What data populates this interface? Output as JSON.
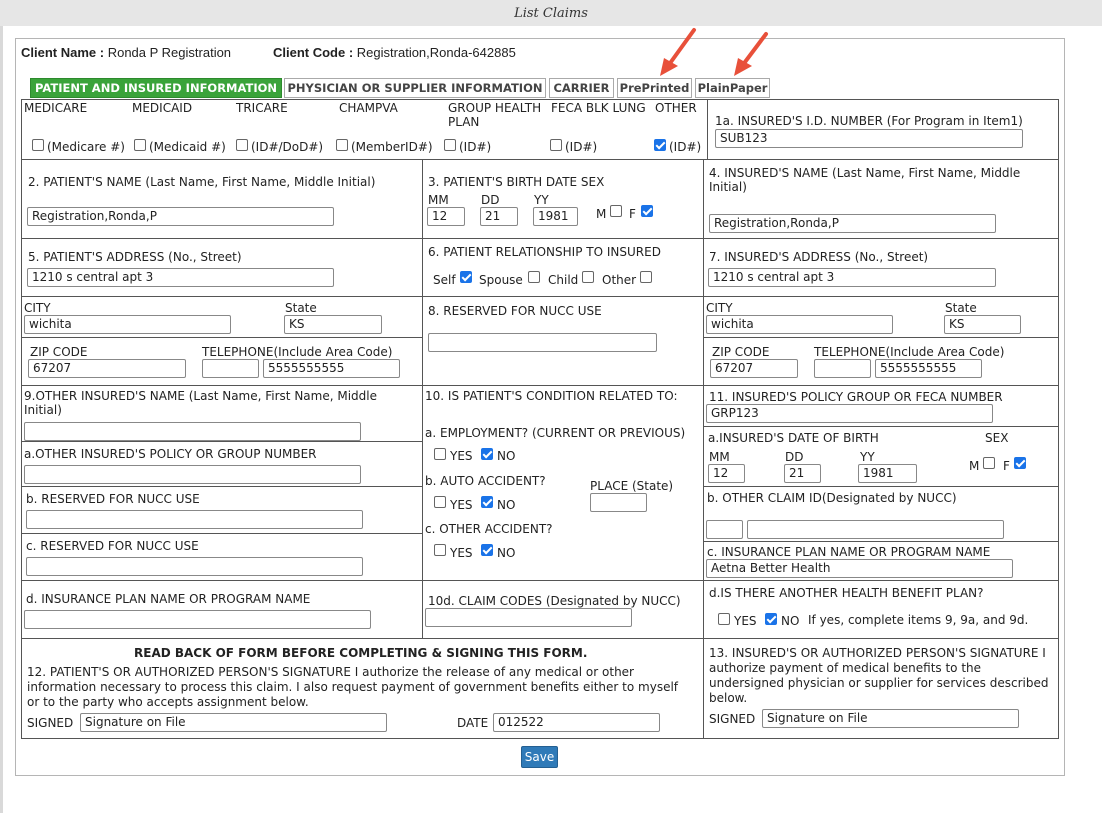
{
  "title": "List Claims",
  "client": {
    "name_label": "Client Name :",
    "name": "Ronda P Registration",
    "code_label": "Client Code :",
    "code": "Registration,Ronda-642885"
  },
  "tabs": [
    {
      "label": "PATIENT AND INSURED INFORMATION",
      "active": true
    },
    {
      "label": "PHYSICIAN OR SUPPLIER INFORMATION",
      "active": false
    },
    {
      "label": "CARRIER",
      "active": false
    },
    {
      "label": "PrePrinted",
      "active": false
    },
    {
      "label": "PlainPaper",
      "active": false
    }
  ],
  "accent_colors": {
    "active_tab": "#3aa33a",
    "save_button": "#2f7ab8",
    "arrow": "#e8503a",
    "checkbox": "#1a73e8"
  },
  "item1": {
    "types": [
      "MEDICARE",
      "MEDICAID",
      "TRICARE",
      "CHAMPVA",
      "GROUP HEALTH PLAN",
      "FECA BLK LUNG",
      "OTHER"
    ],
    "ids": [
      "(Medicare #)",
      "(Medicaid #)",
      "(ID#/DoD#)",
      "(MemberID#)",
      "(ID#)",
      "(ID#)",
      "(ID#)"
    ],
    "checked": [
      false,
      false,
      false,
      false,
      false,
      false,
      true
    ]
  },
  "item1a": {
    "label": "1a. INSURED'S I.D. NUMBER (For Program in Item1)",
    "value": "SUB123"
  },
  "item2": {
    "label": "2. PATIENT'S NAME (Last Name, First Name, Middle Initial)",
    "value": "Registration,Ronda,P"
  },
  "item3": {
    "label": "3. PATIENT'S BIRTH DATE  SEX",
    "mm_label": "MM",
    "dd_label": "DD",
    "yy_label": "YY",
    "mm": "12",
    "dd": "21",
    "yy": "1981",
    "m_label": "M",
    "f_label": "F",
    "m_checked": false,
    "f_checked": true
  },
  "item4": {
    "label": "4. INSURED'S NAME (Last Name, First Name, Middle Initial)",
    "value": "Registration,Ronda,P"
  },
  "item5": {
    "label": "5. PATIENT'S ADDRESS (No., Street)",
    "value": "1210 s central apt 3",
    "city_label": "CITY",
    "city": "wichita",
    "state_label": "State",
    "state": "KS",
    "zip_label": "ZIP CODE",
    "zip": "67207",
    "tel_label": "TELEPHONE(Include Area Code)",
    "area": "",
    "phone": "5555555555"
  },
  "item6": {
    "label": "6. PATIENT RELATIONSHIP TO INSURED",
    "options": [
      "Self",
      "Spouse",
      "Child",
      "Other"
    ],
    "checked": [
      true,
      false,
      false,
      false
    ]
  },
  "item7": {
    "label": "7. INSURED'S ADDRESS (No., Street)",
    "value": "1210 s central apt 3",
    "city_label": "CITY",
    "city": "wichita",
    "state_label": "State",
    "state": "KS",
    "zip_label": "ZIP CODE",
    "zip": "67207",
    "tel_label": "TELEPHONE(Include Area Code)",
    "area": "",
    "phone": "5555555555"
  },
  "item8": {
    "label": "8. RESERVED FOR NUCC USE",
    "value": ""
  },
  "item9": {
    "label": "9.OTHER INSURED'S NAME (Last Name, First Name, Middle Initial)",
    "value": "",
    "a_label": "a.OTHER INSURED'S POLICY OR GROUP NUMBER",
    "a_value": "",
    "b_label": "b. RESERVED FOR NUCC USE",
    "b_value": "",
    "c_label": "c. RESERVED FOR NUCC USE",
    "c_value": "",
    "d_label": "d. INSURANCE PLAN NAME OR PROGRAM NAME",
    "d_value": ""
  },
  "item10": {
    "label": "10. IS PATIENT'S CONDITION RELATED TO:",
    "a_label": "a. EMPLOYMENT? (CURRENT OR PREVIOUS)",
    "b_label": "b. AUTO ACCIDENT?",
    "place_label": "PLACE (State)",
    "place": "",
    "c_label": "c. OTHER ACCIDENT?",
    "yes_label": "YES",
    "no_label": "NO",
    "d_label": "10d. CLAIM CODES (Designated by NUCC)",
    "d_value": ""
  },
  "item11": {
    "label": "11. INSURED'S POLICY GROUP OR FECA NUMBER",
    "value": "GRP123",
    "a_label": "a.INSURED'S DATE OF BIRTH",
    "sex_label": "SEX",
    "mm_label": "MM",
    "dd_label": "DD",
    "yy_label": "YY",
    "mm": "12",
    "dd": "21",
    "yy": "1981",
    "m_label": "M",
    "f_label": "F",
    "m_checked": false,
    "f_checked": true,
    "b_label": "b. OTHER CLAIM ID(Designated by NUCC)",
    "b_qual": "",
    "b_value": "",
    "c_label": "c. INSURANCE PLAN NAME OR PROGRAM NAME",
    "c_value": "Aetna Better Health",
    "d_label": "d.IS THERE ANOTHER HEALTH BENEFIT PLAN?",
    "yes_label": "YES",
    "no_label": "NO",
    "d_note": "If yes, complete items 9, 9a, and 9d."
  },
  "item12": {
    "heading": "READ BACK OF FORM BEFORE COMPLETING & SIGNING THIS FORM.",
    "text": "12. PATIENT'S OR AUTHORIZED PERSON'S SIGNATURE I authorize the release of any medical or other information necessary to process this claim. I also request payment of government benefits either to myself or to the party who accepts assignment below.",
    "signed_label": "SIGNED",
    "signed": "Signature on File",
    "date_label": "DATE",
    "date": "012522"
  },
  "item13": {
    "text": "13. INSURED'S OR AUTHORIZED PERSON'S SIGNATURE I authorize payment of medical benefits to the undersigned physician or supplier for services described below.",
    "signed_label": "SIGNED",
    "signed": "Signature on File"
  },
  "save_label": "Save"
}
